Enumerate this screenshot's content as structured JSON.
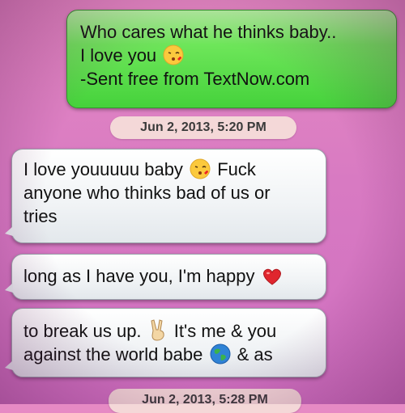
{
  "sent_message": {
    "lines": [
      "Who cares what he thinks baby..",
      "I love you",
      "-Sent free from TextNow.com"
    ],
    "emoji": "kissing-face-icon"
  },
  "timestamps": [
    "Jun 2, 2013, 5:20 PM",
    "Jun 2, 2013, 5:28 PM"
  ],
  "received_messages": [
    {
      "lines": [
        "I love youuuuu baby",
        "Fuck",
        "anyone who thinks bad of us or",
        "tries"
      ],
      "emoji": "kissing-face-icon"
    },
    {
      "lines": [
        "long as I have you, I'm happy"
      ],
      "emoji": "heart-icon"
    },
    {
      "lines": [
        "to break us up.",
        "It's me & you",
        "against the world babe",
        "& as"
      ],
      "emoji": [
        "victory-hand-icon",
        "globe-icon"
      ]
    }
  ],
  "colors": {
    "sent_bubble": "#5ee04c",
    "received_bubble": "#f0f3f5",
    "background": "#dc80c3",
    "timestamp_pill": "#f4d8d8"
  }
}
